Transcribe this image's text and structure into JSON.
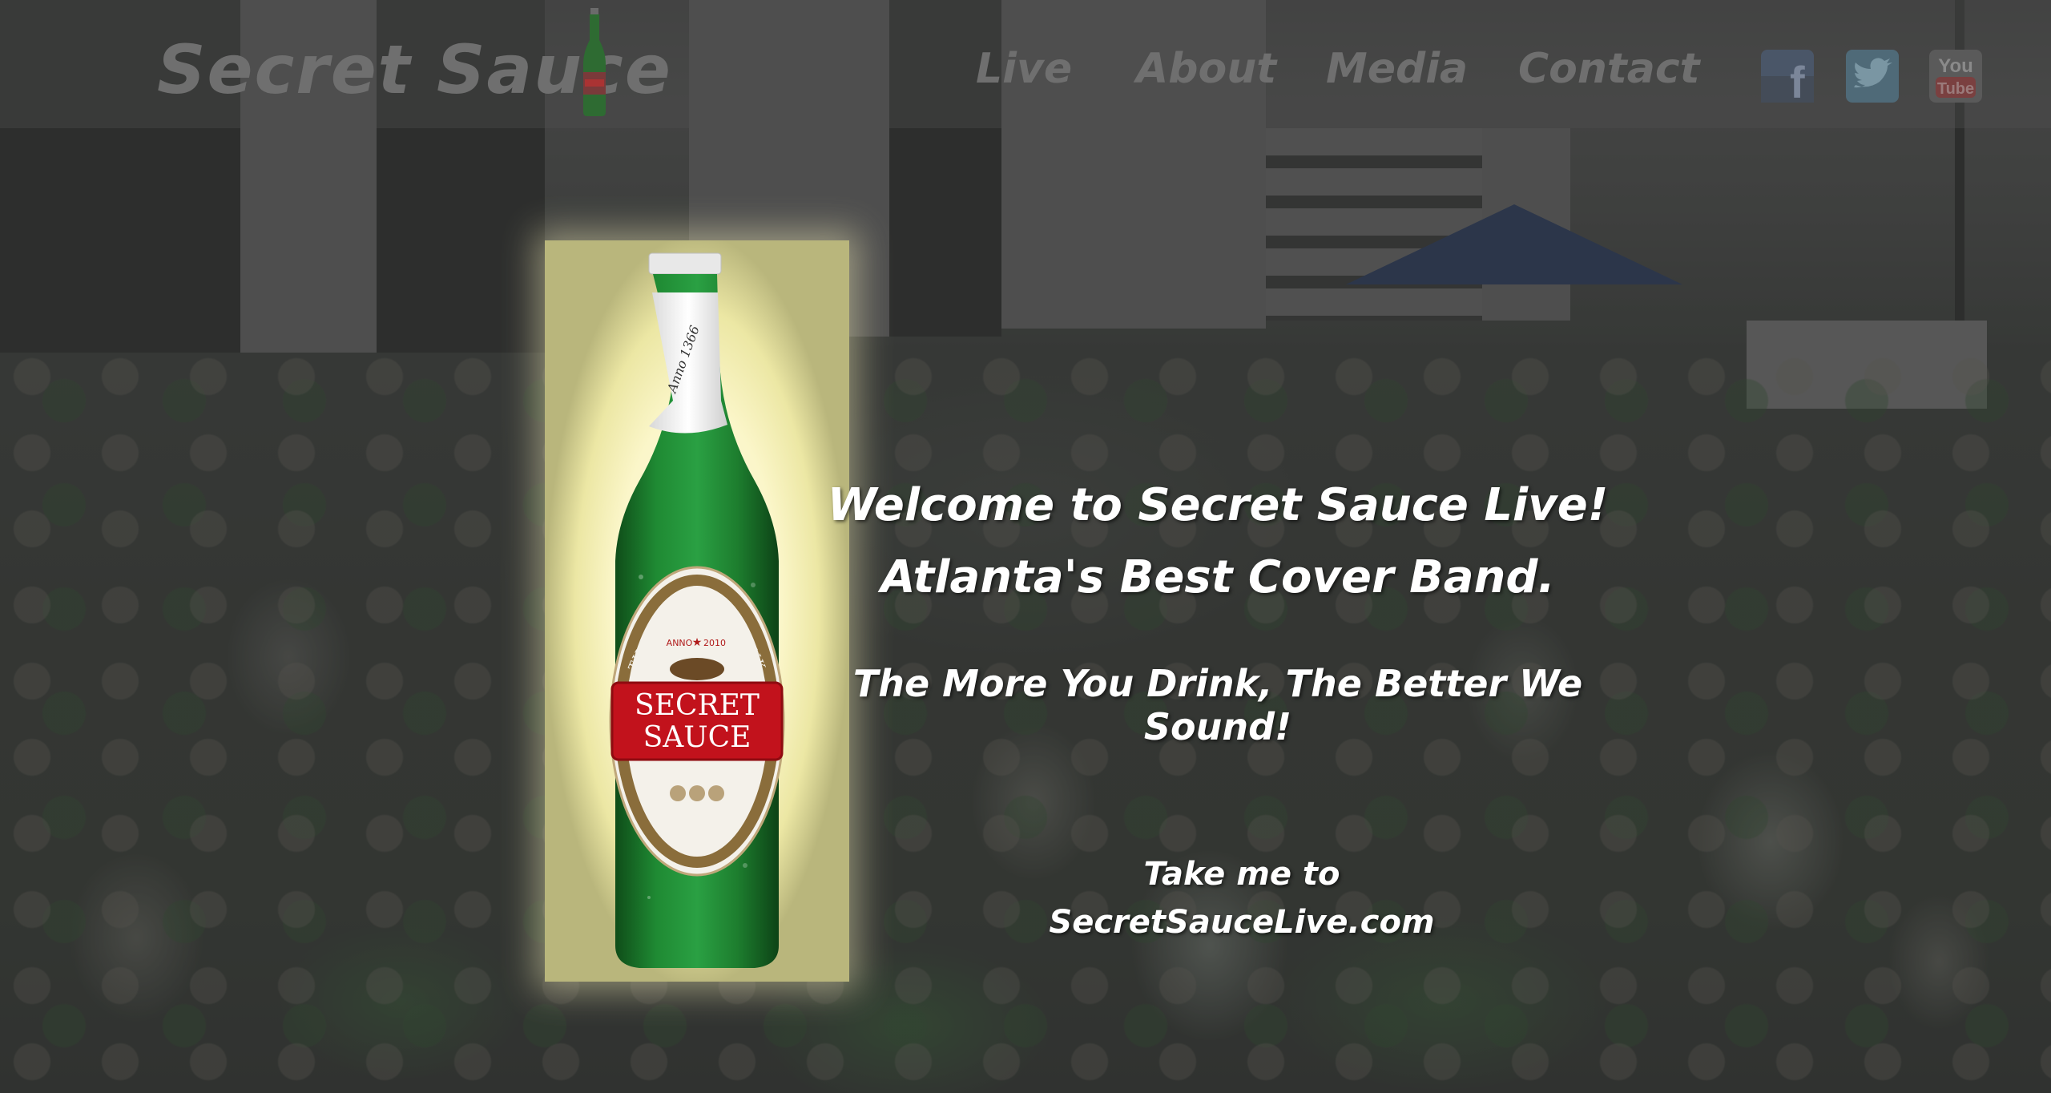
{
  "header": {
    "logo_text": "Secret Sauce",
    "nav": [
      {
        "label": "Live"
      },
      {
        "label": "About"
      },
      {
        "label": "Media"
      },
      {
        "label": "Contact"
      }
    ],
    "social": [
      {
        "name": "facebook-icon",
        "glyph": "f"
      },
      {
        "name": "twitter-icon",
        "glyph": "t"
      },
      {
        "name": "youtube-icon",
        "glyph_top": "You",
        "glyph_bottom": "Tube"
      }
    ]
  },
  "bottle_label": {
    "neck_text": "Anno 1366",
    "arc_top": "THE MORE YOU DRINK",
    "anno": "ANNO",
    "year": "2010",
    "brand_line1": "SECRET",
    "brand_line2": "SAUCE",
    "arc_bottom": "THE BETTER WE SOUND"
  },
  "main": {
    "welcome_line1": "Welcome to Secret Sauce Live!",
    "welcome_line2": "Atlanta's Best Cover Band.",
    "tagline": "The More You Drink, The Better We Sound!",
    "link_line1": "Take me to",
    "link_line2": "SecretSauceLive.com"
  },
  "colors": {
    "bottle_green": "#1e7a2c",
    "label_red": "#c2121c",
    "glow": "#fbf6c9",
    "nav_text": "#6f6f6f"
  }
}
